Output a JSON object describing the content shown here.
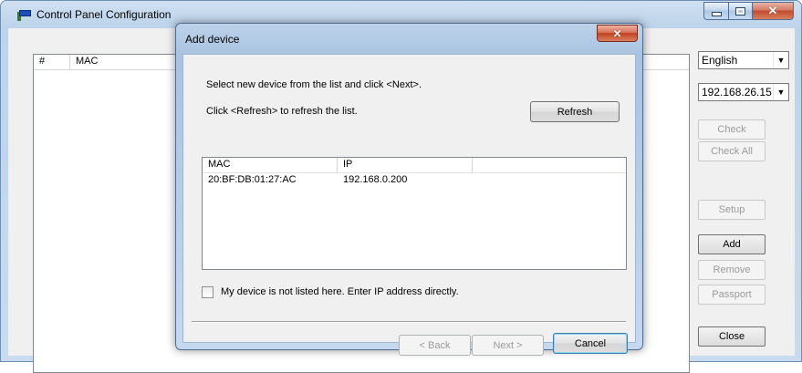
{
  "main_window": {
    "title": "Control Panel Configuration",
    "list_columns": [
      "#",
      "MAC"
    ],
    "language": "English",
    "ip_select": "192.168.26.15",
    "buttons": {
      "check": "Check",
      "check_all": "Check All",
      "setup": "Setup",
      "add": "Add",
      "remove": "Remove",
      "passport": "Passport",
      "close": "Close"
    }
  },
  "dialog": {
    "title": "Add device",
    "instruction": "Select new device from the list and click <Next>.",
    "refresh_hint": "Click <Refresh> to refresh the list.",
    "refresh_button": "Refresh",
    "columns": [
      "MAC",
      "IP"
    ],
    "devices": [
      {
        "mac": "20:BF:DB:01:27:AC",
        "ip": "192.168.0.200"
      }
    ],
    "manual_checkbox_label": "My device is not listed here. Enter IP address directly.",
    "manual_checked": false,
    "back_button": "< Back",
    "next_button": "Next >",
    "cancel_button": "Cancel"
  },
  "icons": {
    "app": "app-icon",
    "dropdown": "chevron-down-icon",
    "close": "close-icon"
  }
}
